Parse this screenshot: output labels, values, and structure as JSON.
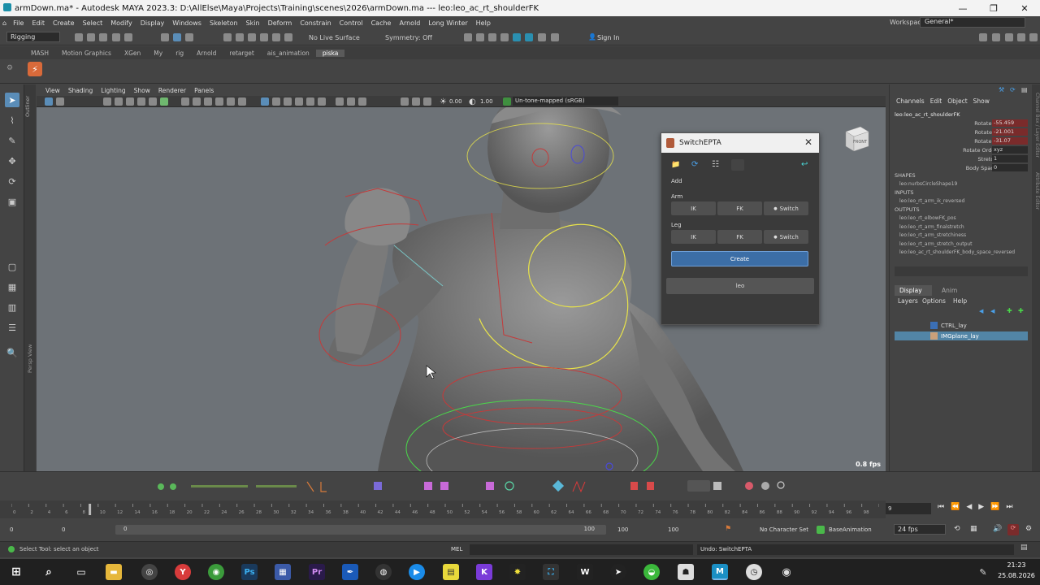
{
  "titlebar": {
    "title": "armDown.ma* - Autodesk MAYA 2023.3: D:\\AllElse\\Maya\\Projects\\Training\\scenes\\2026\\armDown.ma  ---  leo:leo_ac_rt_shoulderFK",
    "min": "—",
    "max": "❐",
    "close": "✕"
  },
  "menubar": [
    "File",
    "Edit",
    "Create",
    "Select",
    "Modify",
    "Display",
    "Windows",
    "Skeleton",
    "Skin",
    "Deform",
    "Constrain",
    "Control",
    "Cache",
    "Arnold",
    "Long Winter",
    "Help"
  ],
  "workspace": {
    "label": "Workspace:",
    "value": "General*"
  },
  "statusline": {
    "mode": "Rigging",
    "live_surface": "No Live Surface",
    "symmetry": "Symmetry: Off",
    "sign_in": "Sign In"
  },
  "shelf_tabs": [
    "MASH",
    "Motion Graphics",
    "XGen",
    "My",
    "rig",
    "Arnold",
    "retarget",
    "ais_animation",
    "piska"
  ],
  "shelf_active": "piska",
  "viewport": {
    "menus": [
      "View",
      "Shading",
      "Lighting",
      "Show",
      "Renderer",
      "Panels"
    ],
    "near": "0.00",
    "far": "1.00",
    "colorspace": "Un-tone-mapped (sRGB)",
    "fps": "0.8 fps",
    "sidebar_label": "Persp View",
    "viewcube_label": "FRONT",
    "outliner_label": "Outliner"
  },
  "channel_box": {
    "menus": [
      "Channels",
      "Edit",
      "Object",
      "Show"
    ],
    "node": "leo:leo_ac_rt_shoulderFK",
    "attrs": [
      {
        "name": "Rotate X",
        "value": "-55.459",
        "keyed": true
      },
      {
        "name": "Rotate Y",
        "value": "-21.001",
        "keyed": true
      },
      {
        "name": "Rotate Z",
        "value": "-31.07",
        "keyed": true
      },
      {
        "name": "Rotate Order",
        "value": "xyz",
        "keyed": false
      },
      {
        "name": "Stretch",
        "value": "1",
        "keyed": false
      },
      {
        "name": "Body Space",
        "value": "0",
        "keyed": false
      }
    ],
    "shapes_label": "SHAPES",
    "shapes": [
      "leo:nurbsCircleShape19"
    ],
    "inputs_label": "INPUTS",
    "inputs": [
      "leo:leo_rt_arm_ik_reversed"
    ],
    "outputs_label": "OUTPUTS",
    "outputs": [
      "leo:leo_rt_elbowFK_pos",
      "leo:leo_rt_arm_finalstretch",
      "leo:leo_rt_arm_stretchiness",
      "leo:leo_rt_arm_stretch_output",
      "leo:leo_ac_rt_shoulderFK_body_space_reversed"
    ]
  },
  "layer_editor": {
    "tabs": [
      "Display",
      "Anim"
    ],
    "menus": [
      "Layers",
      "Options",
      "Help"
    ],
    "layers": [
      {
        "name": "CTRL_lay",
        "color": "#3b6fb5",
        "selected": false
      },
      {
        "name": "IMGplane_lay",
        "color": "#c9a07a",
        "selected": true
      }
    ]
  },
  "right_strip": "Channel Box / Layer Editor",
  "right_strip2": "Attribute Editor",
  "switch_window": {
    "title": "SwitchEPTA",
    "close": "✕",
    "add_label": "Add",
    "arm_label": "Arm",
    "leg_label": "Leg",
    "ik": "IK",
    "fk": "FK",
    "switch": "Switch",
    "create": "Create",
    "character": "leo"
  },
  "timeline": {
    "ticks": [
      "0",
      "2",
      "4",
      "6",
      "8",
      "10",
      "12",
      "14",
      "16",
      "18",
      "20",
      "22",
      "24",
      "26",
      "28",
      "30",
      "32",
      "34",
      "36",
      "38",
      "40",
      "42",
      "44",
      "46",
      "48",
      "50",
      "52",
      "54",
      "56",
      "58",
      "60",
      "62",
      "64",
      "66",
      "68",
      "70",
      "72",
      "74",
      "76",
      "78",
      "80",
      "82",
      "84",
      "86",
      "88",
      "90",
      "92",
      "94",
      "96",
      "98",
      "100"
    ],
    "current_frame": "9",
    "current_index": 9
  },
  "range": {
    "start": "0",
    "start2": "0",
    "range_start": "0",
    "range_end": "100",
    "end": "100",
    "end2": "100",
    "character_set": "No Character Set",
    "anim_layer": "BaseAnimation",
    "fps": "24 fps"
  },
  "cmdline": {
    "help": "Select Tool: select an object",
    "lang": "MEL",
    "result": "Undo: SwitchEPTA"
  },
  "taskbar": {
    "time": "21:23",
    "date": "25.08.2026"
  }
}
